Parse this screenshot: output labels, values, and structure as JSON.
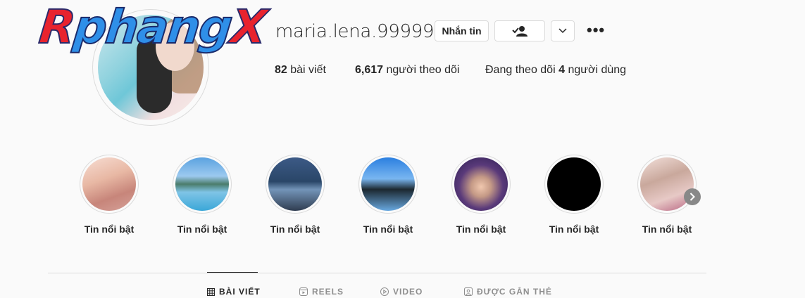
{
  "watermark": {
    "part1": "R",
    "part2": "phang",
    "part3": "X"
  },
  "profile": {
    "username": "maria.lena.99999",
    "message_button": "Nhắn tin",
    "more_icon": "•••"
  },
  "stats": {
    "posts_count": "82",
    "posts_label": "bài viết",
    "followers_count": "6,617",
    "followers_label": "người theo dõi",
    "following_prefix": "Đang theo dõi",
    "following_count": "4",
    "following_suffix": "người dùng"
  },
  "highlights": [
    {
      "label": "Tin nổi bật"
    },
    {
      "label": "Tin nổi bật"
    },
    {
      "label": "Tin nổi bật"
    },
    {
      "label": "Tin nổi bật"
    },
    {
      "label": "Tin nổi bật"
    },
    {
      "label": "Tin nổi bật"
    },
    {
      "label": "Tin nổi bật"
    }
  ],
  "tabs": [
    {
      "label": "BÀI VIẾT",
      "icon": "grid-icon",
      "active": true
    },
    {
      "label": "REELS",
      "icon": "reels-icon",
      "active": false
    },
    {
      "label": "VIDEO",
      "icon": "play-icon",
      "active": false
    },
    {
      "label": "ĐƯỢC GẮN THẺ",
      "icon": "tag-icon",
      "active": false
    }
  ]
}
